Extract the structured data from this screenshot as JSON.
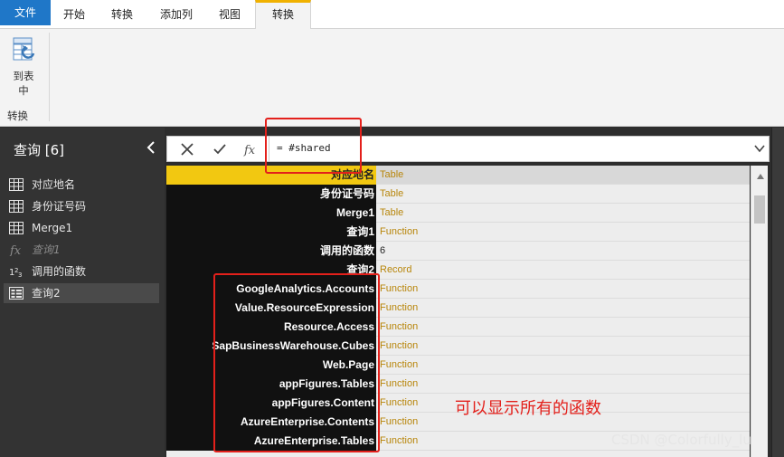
{
  "ribbon": {
    "tabs": [
      "文件",
      "开始",
      "转换",
      "添加列",
      "视图",
      "转换"
    ],
    "to_table_label": "到表\n中",
    "to_table_line1": "到表",
    "to_table_line2": "中",
    "group_label": "转换"
  },
  "sidebar": {
    "title": "查询 [6]",
    "items": [
      {
        "label": "对应地名",
        "icon": "table-icon"
      },
      {
        "label": "身份证号码",
        "icon": "table-icon"
      },
      {
        "label": "Merge1",
        "icon": "table-icon"
      },
      {
        "label": "查询1",
        "icon": "function-icon"
      },
      {
        "label": "调用的函数",
        "icon": "number-icon"
      },
      {
        "label": "查询2",
        "icon": "record-icon"
      }
    ]
  },
  "formula": {
    "value": "= #shared"
  },
  "grid": {
    "rows": [
      {
        "name": "对应地名",
        "value": "Table"
      },
      {
        "name": "身份证号码",
        "value": "Table"
      },
      {
        "name": "Merge1",
        "value": "Table"
      },
      {
        "name": "查询1",
        "value": "Function"
      },
      {
        "name": "调用的函数",
        "value": "6"
      },
      {
        "name": "查询2",
        "value": "Record"
      },
      {
        "name": "GoogleAnalytics.Accounts",
        "value": "Function"
      },
      {
        "name": "Value.ResourceExpression",
        "value": "Function"
      },
      {
        "name": "Resource.Access",
        "value": "Function"
      },
      {
        "name": "SapBusinessWarehouse.Cubes",
        "value": "Function"
      },
      {
        "name": "Web.Page",
        "value": "Function"
      },
      {
        "name": "appFigures.Tables",
        "value": "Function"
      },
      {
        "name": "appFigures.Content",
        "value": "Function"
      },
      {
        "name": "AzureEnterprise.Contents",
        "value": "Function"
      },
      {
        "name": "AzureEnterprise.Tables",
        "value": "Function"
      }
    ]
  },
  "annotation": "可以显示所有的函数",
  "watermark": "CSDN @Colorfully_lu",
  "colors": {
    "accent": "#f2c811",
    "file_tab": "#1f77c8",
    "annotation_red": "#e3201b",
    "function_text": "#b8860b"
  }
}
